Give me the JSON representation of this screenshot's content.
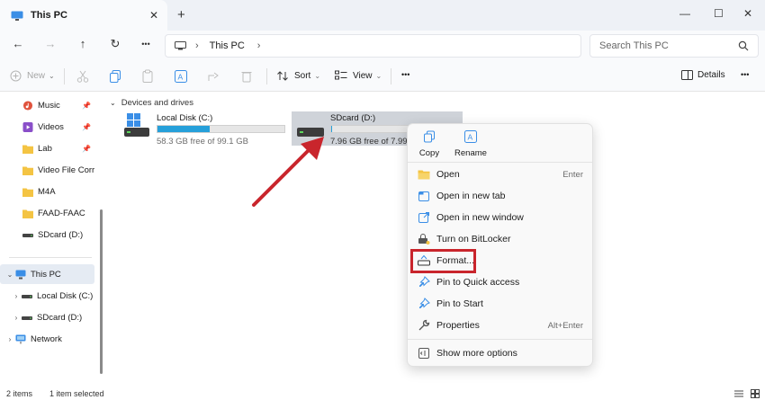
{
  "window": {
    "tab_title": "This PC",
    "tab_close": "✕",
    "new_tab": "+",
    "min": "—",
    "max": "☐",
    "close": "✕"
  },
  "address": {
    "back": "←",
    "forward": "→",
    "up": "↑",
    "refresh": "↻",
    "more": "•••",
    "crumb_chevron": "›",
    "crumb": "This PC",
    "crumb_trailing": "›",
    "search_placeholder": "Search This PC"
  },
  "toolbar": {
    "new_label": "New",
    "sort_label": "Sort",
    "view_label": "View",
    "more": "•••",
    "details_label": "Details",
    "details_more": "•••",
    "dropdown_chevron": "⌄"
  },
  "sidebar": {
    "pinned": [
      {
        "label": "Music",
        "icon": "music-icon",
        "color": "#e0533d"
      },
      {
        "label": "Videos",
        "icon": "videos-icon",
        "color": "#8a4fc9"
      },
      {
        "label": "Lab",
        "icon": "folder-icon",
        "color": "#f4c443"
      },
      {
        "label": "Video File Corrup",
        "icon": "folder-icon",
        "color": "#f4c443"
      },
      {
        "label": "M4A",
        "icon": "folder-icon",
        "color": "#f4c443"
      },
      {
        "label": "FAAD-FAAC",
        "icon": "folder-icon",
        "color": "#f4c443"
      },
      {
        "label": "SDcard (D:)",
        "icon": "drive-icon",
        "color": "#444444"
      }
    ],
    "tree": [
      {
        "label": "This PC",
        "expander": "⌄",
        "selected": true
      },
      {
        "label": "Local Disk (C:)",
        "expander": "›"
      },
      {
        "label": "SDcard (D:)",
        "expander": "›"
      },
      {
        "label": "Network",
        "expander": "›"
      }
    ]
  },
  "main": {
    "section_chevron": "⌄",
    "section": "Devices and drives",
    "drives": [
      {
        "name": "Local Disk (C:)",
        "free": "58.3 GB free of 99.1 GB",
        "used_fraction": 0.41,
        "selected": false
      },
      {
        "name": "SDcard (D:)",
        "free": "7.96 GB free of 7.99 G",
        "used_fraction": 0.004,
        "selected": true
      }
    ]
  },
  "context_menu": {
    "copy": "Copy",
    "rename": "Rename",
    "items": [
      {
        "label": "Open",
        "shortcut": "Enter",
        "icon": "folder-open-icon"
      },
      {
        "label": "Open in new tab",
        "shortcut": "",
        "icon": "new-tab-icon"
      },
      {
        "label": "Open in new window",
        "shortcut": "",
        "icon": "new-window-icon"
      },
      {
        "label": "Turn on BitLocker",
        "shortcut": "",
        "icon": "bitlocker-icon"
      },
      {
        "label": "Format...",
        "shortcut": "",
        "icon": "format-icon"
      },
      {
        "label": "Pin to Quick access",
        "shortcut": "",
        "icon": "pin-icon"
      },
      {
        "label": "Pin to Start",
        "shortcut": "",
        "icon": "pin-start-icon"
      },
      {
        "label": "Properties",
        "shortcut": "Alt+Enter",
        "icon": "properties-icon"
      },
      {
        "label": "Show more options",
        "shortcut": "",
        "icon": "show-more-icon"
      }
    ]
  },
  "status": {
    "count": "2 items",
    "selection": "1 item selected"
  },
  "colors": {
    "accent": "#26a0da",
    "annotation_red": "#c9252c"
  }
}
